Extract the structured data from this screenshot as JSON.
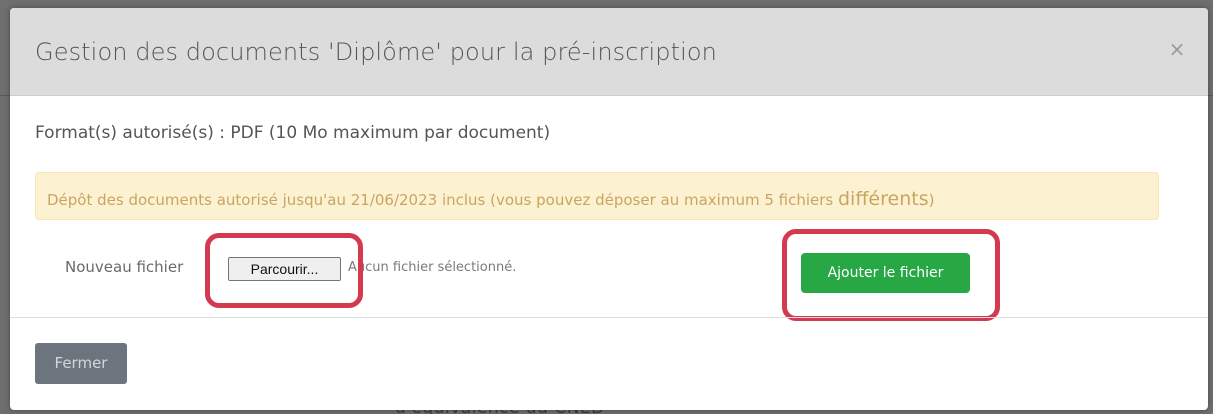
{
  "modal": {
    "title": "Gestion des documents 'Diplôme' pour la pré-inscription",
    "close_symbol": "×",
    "format_info": "Format(s) autorisé(s) : PDF (10 Mo maximum par document)",
    "alert": {
      "text_main": "Dépôt des documents autorisé jusqu'au 21/06/2023 inclus (vous pouvez déposer au maximum 5 fichiers ",
      "text_big": "différents",
      "text_end": ")",
      "background_color": "#fcf2d2",
      "text_color": "#c9a560"
    },
    "upload": {
      "label": "Nouveau fichier",
      "browse_label": "Parcourir...",
      "file_status": "Aucun fichier sélectionné.",
      "add_button_label": "Ajouter le fichier",
      "add_button_color": "#28a745"
    },
    "footer": {
      "close_button_label": "Fermer",
      "close_button_color": "#6c757d"
    }
  },
  "annotations": {
    "highlight_color": "#d33a4f"
  },
  "background": {
    "partial_text": "d'équivalence du CNED"
  }
}
